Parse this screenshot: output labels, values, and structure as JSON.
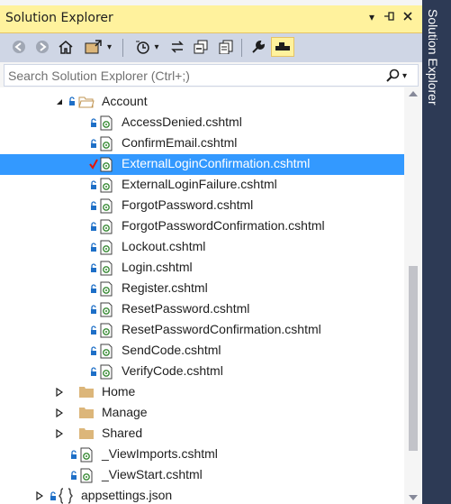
{
  "window": {
    "title": "Solution Explorer",
    "sidetab_label": "Solution Explorer"
  },
  "search": {
    "placeholder": "Search Solution Explorer (Ctrl+;)"
  },
  "colors": {
    "titlebar": "#fff29d",
    "selection": "#3399ff",
    "sidetab": "#2d3a55",
    "toolbar": "#cfd6e5"
  },
  "toolbar": {
    "icons": [
      "back-icon",
      "forward-icon",
      "home-icon",
      "sync-active-document-icon",
      "dropdown-icon",
      "pending-changes-filter-icon",
      "dropdown-icon",
      "sync-icon",
      "collapse-all-icon",
      "show-all-files-icon",
      "properties-icon",
      "preview-selected-items-icon"
    ]
  },
  "tree": {
    "folder_account": "Account",
    "files": [
      "AccessDenied.cshtml",
      "ConfirmEmail.cshtml",
      "ExternalLoginConfirmation.cshtml",
      "ExternalLoginFailure.cshtml",
      "ForgotPassword.cshtml",
      "ForgotPasswordConfirmation.cshtml",
      "Lockout.cshtml",
      "Login.cshtml",
      "Register.cshtml",
      "ResetPassword.cshtml",
      "ResetPasswordConfirmation.cshtml",
      "SendCode.cshtml",
      "VerifyCode.cshtml"
    ],
    "selected_file": "ExternalLoginConfirmation.cshtml",
    "folders": [
      "Home",
      "Manage",
      "Shared"
    ],
    "view_files": [
      "_ViewImports.cshtml",
      "_ViewStart.cshtml"
    ],
    "appsettings": "appsettings.json"
  }
}
